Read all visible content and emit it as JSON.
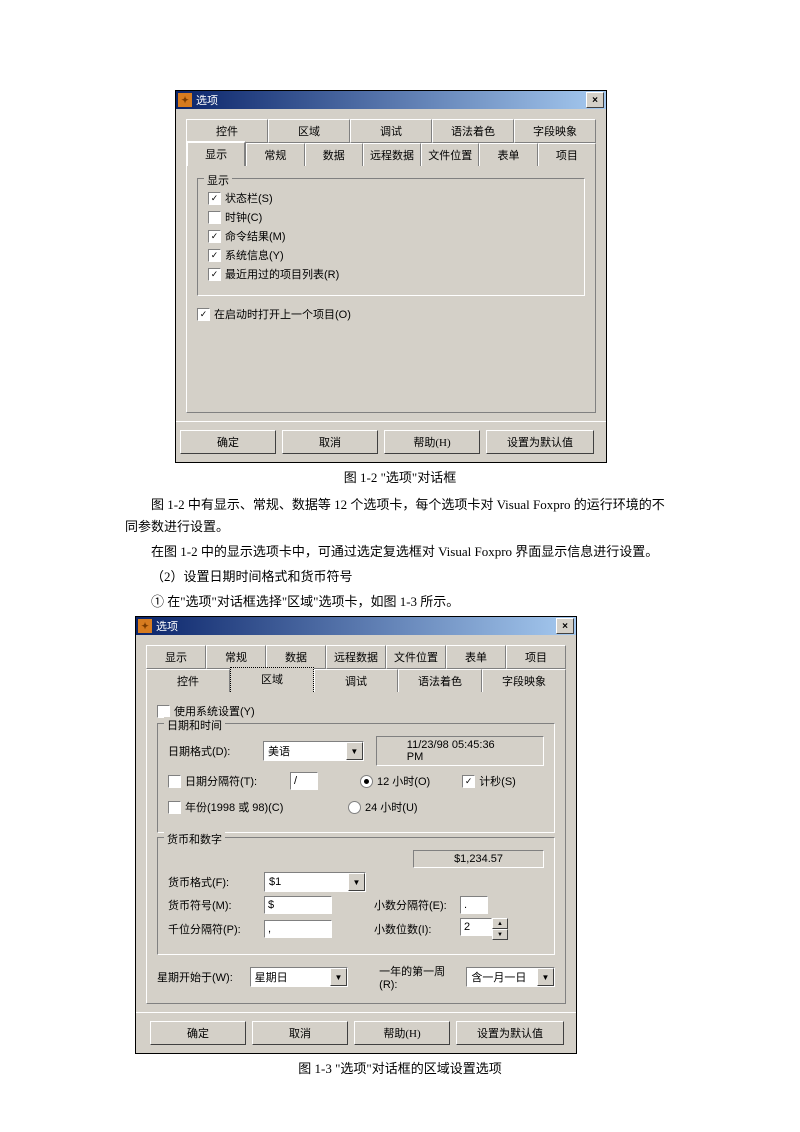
{
  "dlg1": {
    "title": "选项",
    "tabs_top": [
      "控件",
      "区域",
      "调试",
      "语法着色",
      "字段映象"
    ],
    "tabs_bottom": [
      "显示",
      "常规",
      "数据",
      "远程数据",
      "文件位置",
      "表单",
      "项目"
    ],
    "group_display": "显示",
    "checks": [
      {
        "label": "状态栏(S)",
        "on": true
      },
      {
        "label": "时钟(C)",
        "on": false
      },
      {
        "label": "命令结果(M)",
        "on": true
      },
      {
        "label": "系统信息(Y)",
        "on": true
      },
      {
        "label": "最近用过的项目列表(R)",
        "on": true
      }
    ],
    "open_last": {
      "label": "在启动时打开上一个项目(O)",
      "on": true
    },
    "btn_ok": "确定",
    "btn_cancel": "取消",
    "btn_help": "帮助(H)",
    "btn_default": "设置为默认值"
  },
  "caption1": "图 1-2  \"选项\"对话框",
  "para1": "图 1-2 中有显示、常规、数据等 12 个选项卡，每个选项卡对 Visual Foxpro 的运行环境的不同参数进行设置。",
  "para2": "在图 1-2 中的显示选项卡中，可通过选定复选框对 Visual  Foxpro 界面显示信息进行设置。",
  "para3": "（2）设置日期时间格式和货币符号",
  "para4": "①  在\"选项\"对话框选择\"区域\"选项卡，如图 1-3 所示。",
  "dlg2": {
    "title": "选项",
    "tabs_top": [
      "显示",
      "常规",
      "数据",
      "远程数据",
      "文件位置",
      "表单",
      "项目"
    ],
    "tabs_bottom": [
      "控件",
      "区域",
      "调试",
      "语法着色",
      "字段映象"
    ],
    "use_system": {
      "label": "使用系统设置(Y)",
      "on": false
    },
    "g_datetime": "日期和时间",
    "date_format_lbl": "日期格式(D):",
    "date_format_val": "美语",
    "datetime_display": "11/23/98 05:45:36 PM",
    "date_sep": {
      "label": "日期分隔符(T):",
      "on": false,
      "val": "/"
    },
    "hour12": {
      "label": "12 小时(O)",
      "sel": true
    },
    "hour24": {
      "label": "24 小时(U)",
      "sel": false
    },
    "seconds": {
      "label": "计秒(S)",
      "on": true
    },
    "year": {
      "label": "年份(1998 或 98)(C)",
      "on": false
    },
    "g_currency": "货币和数字",
    "curr_disp": "$1,234.57",
    "curr_fmt_lbl": "货币格式(F):",
    "curr_fmt_val": "$1",
    "curr_sym_lbl": "货币符号(M):",
    "curr_sym_val": "$",
    "dec_sep_lbl": "小数分隔符(E):",
    "dec_sep_val": ".",
    "thou_sep_lbl": "千位分隔符(P):",
    "thou_sep_val": ",",
    "dec_dig_lbl": "小数位数(I):",
    "dec_dig_val": "2",
    "week_start_lbl": "星期开始于(W):",
    "week_start_val": "星期日",
    "first_week_lbl": "一年的第一周(R):",
    "first_week_val": "含一月一日",
    "btn_ok": "确定",
    "btn_cancel": "取消",
    "btn_help": "帮助(H)",
    "btn_default": "设置为默认值"
  },
  "caption2": "图 1-3  \"选项\"对话框的区域设置选项"
}
